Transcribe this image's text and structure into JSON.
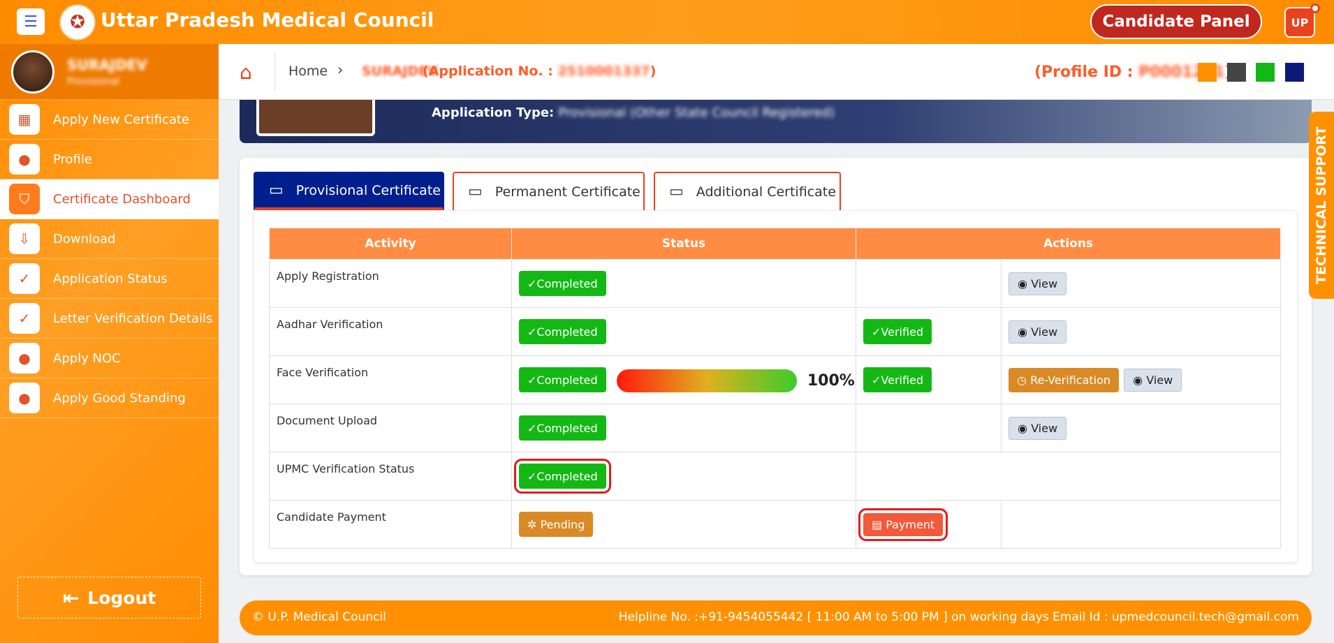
{
  "app": {
    "title": "Uttar Pradesh Medical Council",
    "candidate_panel": "Candidate Panel",
    "user_badge": "UP"
  },
  "user": {
    "name": "SURAJDEV",
    "type": "Provisional"
  },
  "sidebar": {
    "items": [
      {
        "label": "Apply New Certificate",
        "icon": "grid-icon"
      },
      {
        "label": "Profile",
        "icon": "user-icon"
      },
      {
        "label": "Certificate Dashboard",
        "icon": "shield-icon",
        "active": true
      },
      {
        "label": "Download",
        "icon": "download-icon"
      },
      {
        "label": "Application Status",
        "icon": "check-badge-icon"
      },
      {
        "label": "Letter Verification Details",
        "icon": "check-badge-icon"
      },
      {
        "label": "Apply NOC",
        "icon": "user-icon"
      },
      {
        "label": "Apply Good Standing",
        "icon": "user-icon"
      }
    ],
    "logout": "Logout"
  },
  "breadcrumb": {
    "home": "Home",
    "name": "SURAJDEV",
    "application_prefix": "(Application No. : ",
    "application_no": "2510001337",
    "application_suffix": ")",
    "profile_prefix": "(Profile ID : ",
    "profile_id": "P0001211",
    "profile_suffix": ")",
    "swatches": [
      "#ff9100",
      "#444444",
      "#14b814",
      "#0a1a78"
    ]
  },
  "banner": {
    "label": "Application Type:",
    "value": "Provisional (Other State Council Registered)"
  },
  "tabs": [
    {
      "label": "Provisional Certificate",
      "active": true
    },
    {
      "label": "Permanent Certificate",
      "active": false
    },
    {
      "label": "Additional Certificate",
      "active": false
    }
  ],
  "table": {
    "headers": [
      "Activity",
      "Status",
      "Actions"
    ],
    "rows": [
      {
        "activity": "Apply Registration",
        "status": "Completed",
        "verified": "",
        "actions": [
          "View"
        ]
      },
      {
        "activity": "Aadhar Verification",
        "status": "Completed",
        "verified": "Verified",
        "actions": [
          "View"
        ]
      },
      {
        "activity": "Face Verification",
        "status": "Completed",
        "progress": 100,
        "progress_label": "100%",
        "verified": "Verified",
        "actions": [
          "Re-Verification",
          "View"
        ]
      },
      {
        "activity": "Document Upload",
        "status": "Completed",
        "verified": "",
        "actions": [
          "View"
        ]
      },
      {
        "activity": "UPMC Verification Status",
        "status": "Completed"
      },
      {
        "activity": "Candidate Payment",
        "status": "Pending",
        "payment": "Payment"
      }
    ]
  },
  "tech_support": "TECHNICAL SUPPORT",
  "footer": {
    "left": "© U.P. Medical Council",
    "right": "Helpline No. :+91-9454055442 [ 11:00 AM to 5:00 PM ] on working days  Email Id : upmedcouncil.tech@gmail.com"
  }
}
